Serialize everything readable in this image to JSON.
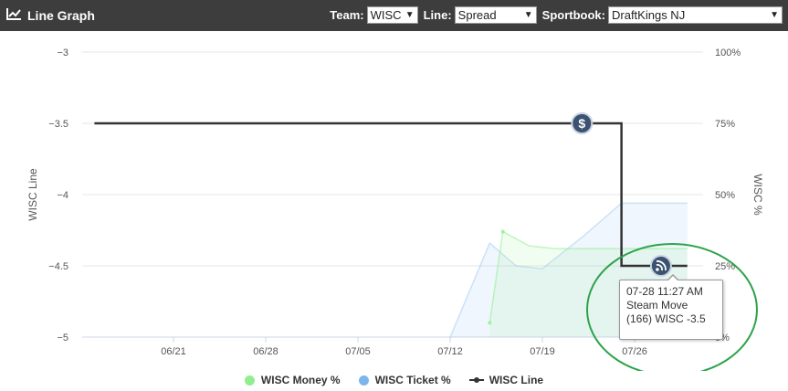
{
  "header": {
    "title": "Line Graph",
    "icon": "line-chart-icon",
    "team_label": "Team:",
    "team_value": "WISC",
    "line_label": "Line:",
    "line_value": "Spread",
    "sportsbook_label": "Sportbook:",
    "sportsbook_value": "DraftKings NJ"
  },
  "tooltip": {
    "line1": "07-28 11:27 AM",
    "line2": "Steam Move",
    "line3": "(166) WISC -3.5"
  },
  "legend": {
    "money_label": "WISC Money %",
    "ticket_label": "WISC Ticket %",
    "line_label": "WISC Line"
  },
  "colors": {
    "header_bg": "#3d3d3d",
    "money": "#90ee90",
    "ticket": "#7cb5ec",
    "line": "#333333",
    "highlight_ring": "#2ea34a",
    "marker": "#3b5270"
  },
  "chart_data": {
    "type": "line",
    "ylabel_left": "WISC Line",
    "ylabel_right": "WISC %",
    "y_left_ticks": [
      "-3",
      "-3.5",
      "-4",
      "-4.5",
      "-5"
    ],
    "y_left_range": [
      -5,
      -3
    ],
    "y_right_ticks": [
      "100%",
      "75%",
      "50%",
      "25%",
      "0%"
    ],
    "y_right_range": [
      0,
      100
    ],
    "x_ticks": [
      "06/21",
      "06/28",
      "07/05",
      "07/12",
      "07/19",
      "07/26"
    ],
    "x_start_date": "06/15",
    "grid": true,
    "series": [
      {
        "name": "WISC Line",
        "axis": "left",
        "points": [
          [
            "06/15",
            -3.5
          ],
          [
            "07/25",
            -3.5
          ],
          [
            "07/25",
            -4.5
          ],
          [
            "07/30",
            -4.5
          ]
        ]
      },
      {
        "name": "WISC Money %",
        "axis": "right",
        "points": [
          [
            "07/15",
            5
          ],
          [
            "07/16",
            37
          ],
          [
            "07/18",
            32
          ],
          [
            "07/20",
            31
          ],
          [
            "07/30",
            31
          ]
        ]
      },
      {
        "name": "WISC Ticket %",
        "axis": "right",
        "points": [
          [
            "07/12",
            0
          ],
          [
            "07/15",
            33
          ],
          [
            "07/17",
            25
          ],
          [
            "07/19",
            24
          ],
          [
            "07/22",
            35
          ],
          [
            "07/25",
            47
          ],
          [
            "07/30",
            47
          ]
        ]
      }
    ],
    "markers": [
      {
        "date": "07/22",
        "value": -3.5,
        "icon": "dollar-sign-icon"
      },
      {
        "date": "07/28",
        "value": -4.5,
        "icon": "rss-icon",
        "tooltip": "07-28 11:27 AM Steam Move (166) WISC -3.5"
      }
    ]
  }
}
